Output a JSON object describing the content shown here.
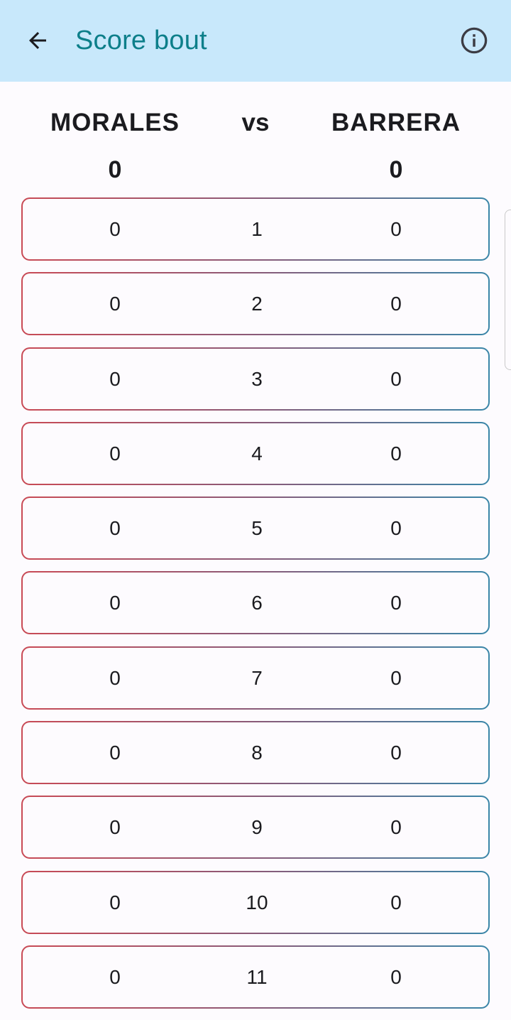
{
  "app_bar": {
    "title": "Score bout",
    "back_icon": "arrow-back-icon",
    "info_icon": "info-icon"
  },
  "header": {
    "left_fighter": "MORALES",
    "vs": "vs",
    "right_fighter": "BARRERA",
    "left_total": "0",
    "right_total": "0"
  },
  "rounds": [
    {
      "left": "0",
      "round": "1",
      "right": "0"
    },
    {
      "left": "0",
      "round": "2",
      "right": "0"
    },
    {
      "left": "0",
      "round": "3",
      "right": "0"
    },
    {
      "left": "0",
      "round": "4",
      "right": "0"
    },
    {
      "left": "0",
      "round": "5",
      "right": "0"
    },
    {
      "left": "0",
      "round": "6",
      "right": "0"
    },
    {
      "left": "0",
      "round": "7",
      "right": "0"
    },
    {
      "left": "0",
      "round": "8",
      "right": "0"
    },
    {
      "left": "0",
      "round": "9",
      "right": "0"
    },
    {
      "left": "0",
      "round": "10",
      "right": "0"
    },
    {
      "left": "0",
      "round": "11",
      "right": "0"
    }
  ],
  "colors": {
    "app_bar_bg": "#c8e8fb",
    "title": "#0d7f8a",
    "red_corner": "#c94a55",
    "blue_corner": "#3a86a8"
  }
}
